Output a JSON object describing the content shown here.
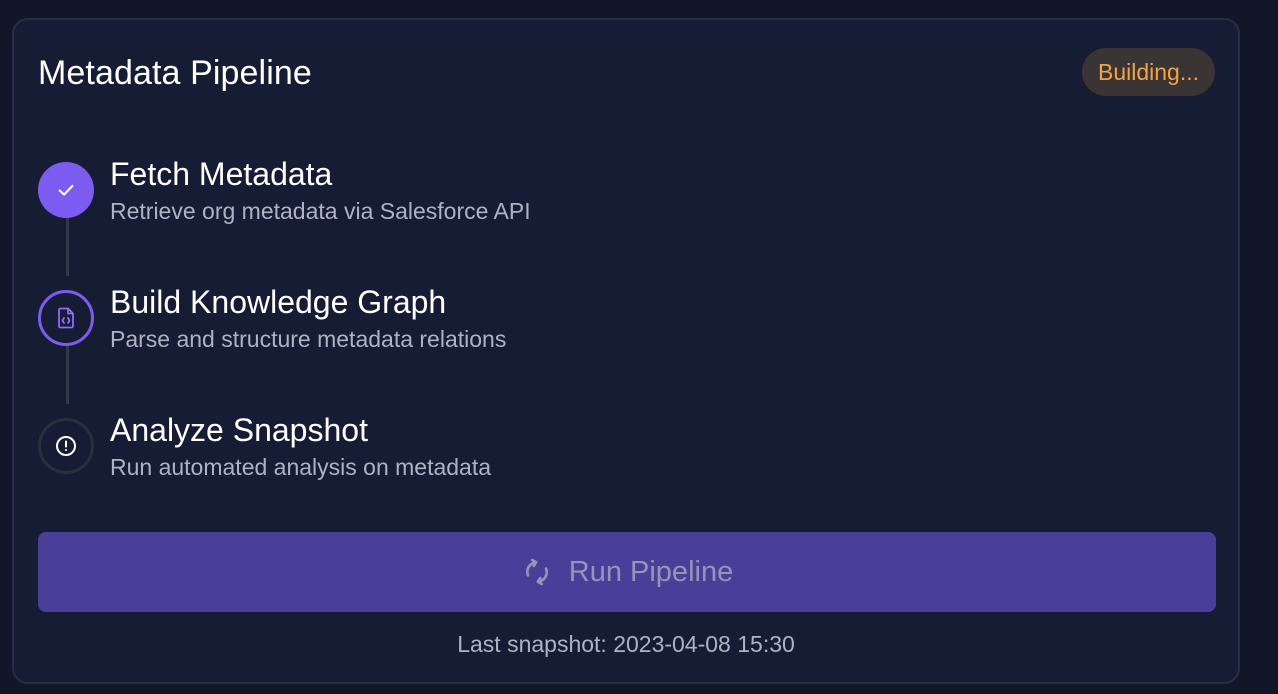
{
  "card": {
    "title": "Metadata Pipeline",
    "status": "Building..."
  },
  "steps": [
    {
      "title": "Fetch Metadata",
      "description": "Retrieve org metadata via Salesforce API",
      "state": "completed",
      "icon": "check-icon"
    },
    {
      "title": "Build Knowledge Graph",
      "description": "Parse and structure metadata relations",
      "state": "in-progress",
      "icon": "file-code-icon"
    },
    {
      "title": "Analyze Snapshot",
      "description": "Run automated analysis on metadata",
      "state": "pending",
      "icon": "alert-circle-icon"
    }
  ],
  "action": {
    "label": "Run Pipeline",
    "icon": "refresh-icon",
    "disabled": true
  },
  "footer": {
    "last_snapshot": "Last snapshot: 2023-04-08 15:30"
  },
  "colors": {
    "background": "#111629",
    "card": "#171c35",
    "accent": "#7c5cf0",
    "badge_text": "#f3a447",
    "button": "#4a3f98"
  }
}
